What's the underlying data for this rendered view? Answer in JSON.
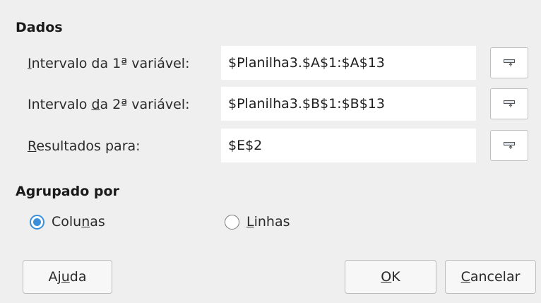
{
  "dados": {
    "title": "Dados",
    "var1": {
      "label_mnemonic": "I",
      "label_rest": "ntervalo da 1ª variável:",
      "value": "$Planilha3.$A$1:$A$13"
    },
    "var2": {
      "label_before": "Intervalo ",
      "label_mnemonic": "d",
      "label_after": "a 2ª variável:",
      "value": "$Planilha3.$B$1:$B$13"
    },
    "results": {
      "label_mnemonic": "R",
      "label_rest": "esultados para:",
      "value": "$E$2"
    },
    "shrink_icon": "shrink-range-icon"
  },
  "agrupado": {
    "title": "Agrupado por",
    "colunas": {
      "label_before": "Colu",
      "label_mnemonic": "n",
      "label_after": "as",
      "checked": true
    },
    "linhas": {
      "label_mnemonic": "L",
      "label_rest": "inhas",
      "checked": false
    }
  },
  "buttons": {
    "help": {
      "before": "Aj",
      "mnemonic": "u",
      "after": "da"
    },
    "ok": {
      "mnemonic": "O",
      "after": "K"
    },
    "cancel": {
      "mnemonic": "C",
      "after": "ancelar"
    }
  },
  "colors": {
    "accent": "#3b8fd9",
    "dialog_background": "#efefef",
    "field_background": "#ffffff"
  }
}
